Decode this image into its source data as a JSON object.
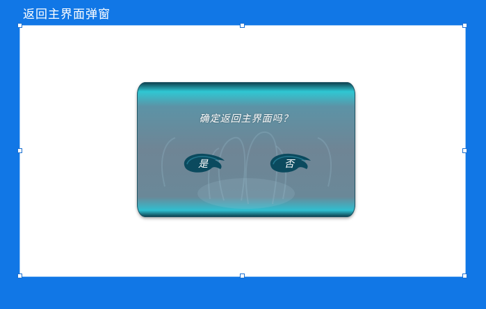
{
  "window": {
    "title": "返回主界面弹窗"
  },
  "dialog": {
    "question": "确定返回主界面吗？",
    "yes_label": "是",
    "no_label": "否"
  },
  "colors": {
    "background": "#1177e6",
    "canvas": "#ffffff",
    "dialog_body": "#6f8595",
    "dialog_glow": "#2fc7d3",
    "ink_button": "#0b4a5e"
  }
}
